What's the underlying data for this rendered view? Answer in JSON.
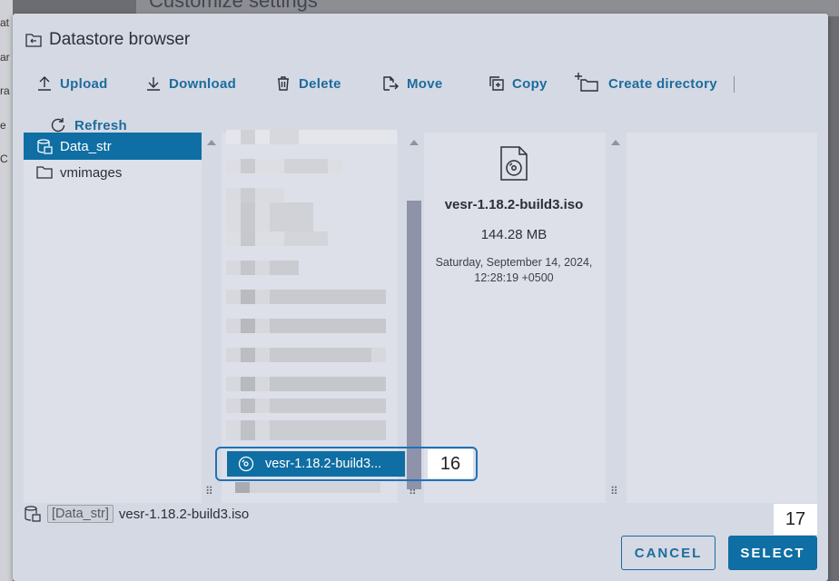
{
  "background": {
    "page_title": "Customize settings",
    "side_fragments": [
      "at",
      "ar",
      "ra",
      "e",
      "C"
    ]
  },
  "dialog": {
    "title": "Datastore browser"
  },
  "toolbar": {
    "upload": "Upload",
    "download": "Download",
    "delete": "Delete",
    "move": "Move",
    "copy": "Copy",
    "create_directory": "Create directory",
    "refresh": "Refresh"
  },
  "tree": {
    "items": [
      {
        "label": "Data_str",
        "selected": true
      },
      {
        "label": "vmimages",
        "selected": false
      }
    ]
  },
  "files": {
    "selected_label": "vesr-1.18.2-build3..."
  },
  "details": {
    "name": "vesr-1.18.2-build3.iso",
    "size": "144.28 MB",
    "modified": "Saturday, September 14, 2024, 12:28:19 +0500"
  },
  "footer": {
    "datastore_tag": "[Data_str]",
    "path": "vesr-1.18.2-build3.iso"
  },
  "buttons": {
    "cancel": "CANCEL",
    "select": "SELECT"
  },
  "callouts": {
    "file": "16",
    "select": "17"
  },
  "colors": {
    "accent": "#0f6ea3",
    "link": "#1c6c9e",
    "dialog_bg": "#d5d9e3"
  }
}
